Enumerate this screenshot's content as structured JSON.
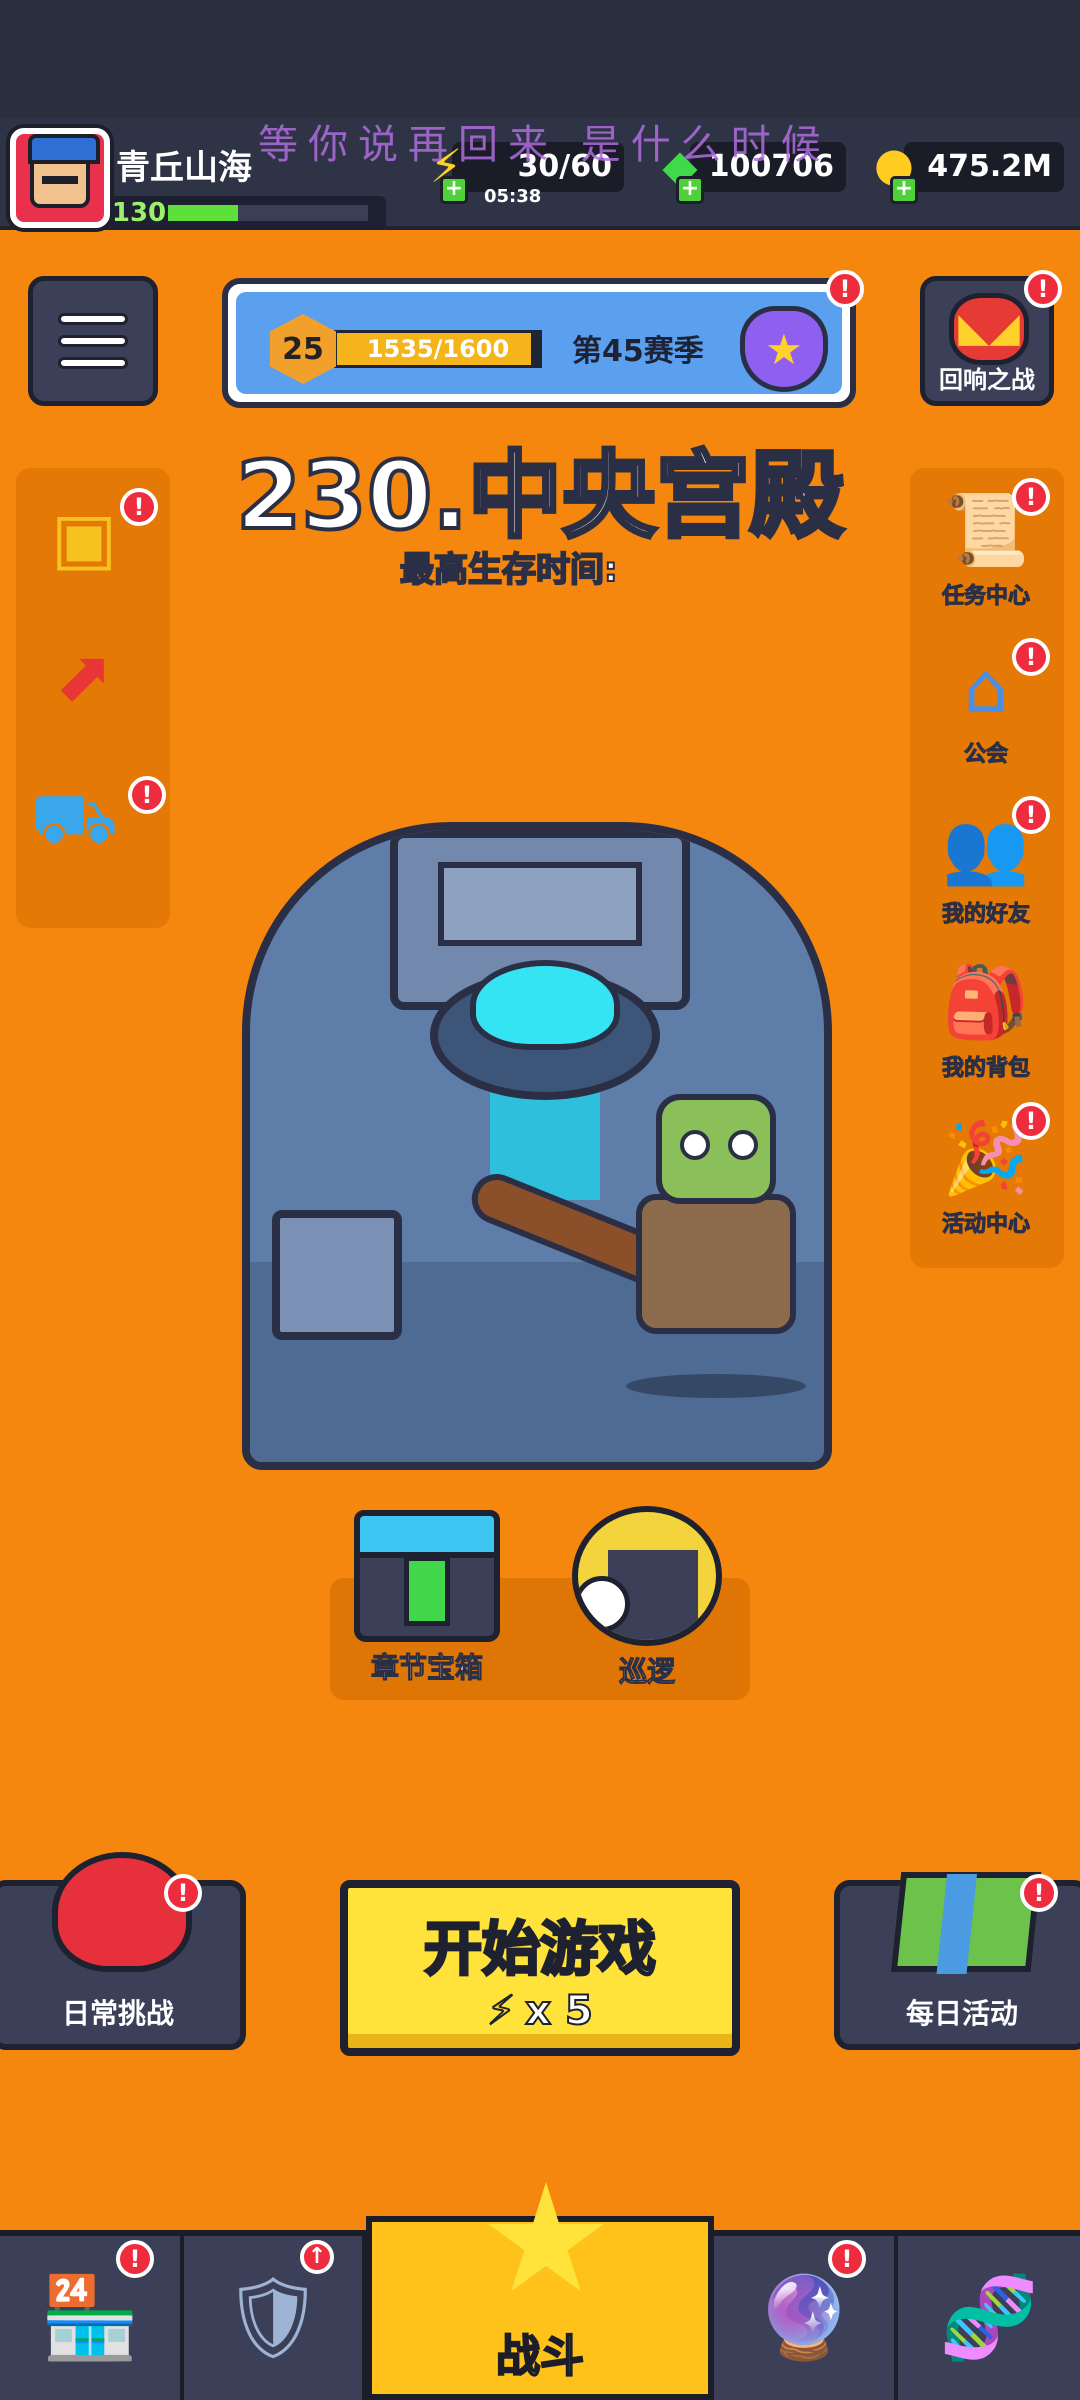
{
  "watermark": "等你说再回来 是什么时候",
  "player": {
    "name": "青丘山海",
    "level": "130",
    "level_progress": 0.35
  },
  "resources": {
    "energy": "30/60",
    "energy_timer": "05:38",
    "gems": "100706",
    "gold": "475.2M"
  },
  "season": {
    "level": "25",
    "progress": "1535/1600",
    "progress_fraction": 0.96,
    "label": "第45赛季"
  },
  "stage": {
    "title": "230.中央宫殿",
    "survival_label": "最高生存时间:"
  },
  "buttons": {
    "echo_battle": "回响之战",
    "start_game": "开始游戏",
    "start_cost": "x 5",
    "daily_challenge": "日常挑战",
    "daily_events": "每日活动"
  },
  "right_menu": [
    {
      "label": "任务中心",
      "icon": "scroll-quill-icon"
    },
    {
      "label": "公会",
      "icon": "guild-house-icon"
    },
    {
      "label": "我的好友",
      "icon": "friends-icon"
    },
    {
      "label": "我的背包",
      "icon": "backpack-icon"
    },
    {
      "label": "活动中心",
      "icon": "party-horn-icon"
    }
  ],
  "rewards": {
    "chapter_chest": "章节宝箱",
    "patrol": "巡逻"
  },
  "badges": {
    "exclamation": "!",
    "up_arrow": "↑"
  },
  "nav": {
    "battle": "战斗"
  },
  "colors": {
    "background": "#f5870f",
    "panel_dark": "#3b4058",
    "alert_red": "#ee2c3d",
    "start_yellow": "#ffe23a"
  }
}
